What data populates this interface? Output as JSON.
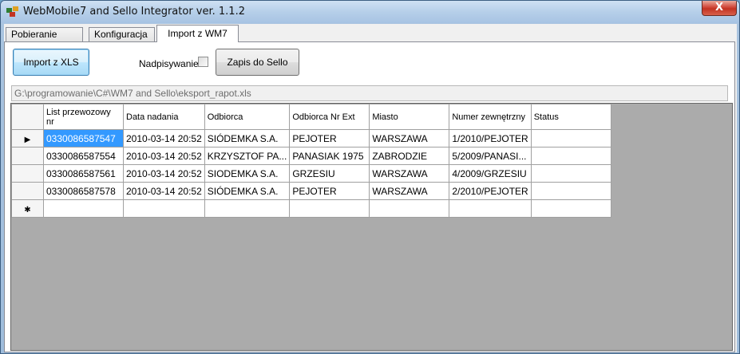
{
  "window": {
    "title": "WebMobile7 and Sello Integrator ver. 1.1.2",
    "close_label": "X"
  },
  "tabs": [
    {
      "label": "Pobieranie Danych"
    },
    {
      "label": "Konfiguracja"
    },
    {
      "label": "Import z WM7"
    }
  ],
  "toolbar": {
    "import_label": "Import z XLS",
    "overwrite_label": "Nadpisywanie",
    "overwrite_checked": false,
    "save_label": "Zapis do Sello"
  },
  "path": {
    "value": "G:\\programowanie\\C#\\WM7 and Sello\\eksport_rapot.xls"
  },
  "grid": {
    "columns": [
      "List przewozowy nr",
      "Data nadania",
      "Odbiorca",
      "Odbiorca Nr Ext",
      "Miasto",
      "Numer zewnętrzny",
      "Status"
    ],
    "rows": [
      [
        "0330086587547",
        "2010-03-14 20:52",
        "SIÓDEMKA S.A.",
        "PEJOTER",
        "WARSZAWA",
        "1/2010/PEJOTER",
        ""
      ],
      [
        "0330086587554",
        "2010-03-14 20:52",
        "KRZYSZTOF PA...",
        "PANASIAK 1975",
        "ZABRODZIE",
        "5/2009/PANASI...",
        ""
      ],
      [
        "0330086587561",
        "2010-03-14 20:52",
        "SIODEMKA S.A.",
        "GRZESIU",
        "WARSZAWA",
        "4/2009/GRZESIU",
        ""
      ],
      [
        "0330086587578",
        "2010-03-14 20:52",
        "SIÓDEMKA S.A.",
        "PEJOTER",
        "WARSZAWA",
        "2/2010/PEJOTER",
        ""
      ]
    ],
    "current_row_marker": "▶",
    "new_row_marker": "✱"
  }
}
